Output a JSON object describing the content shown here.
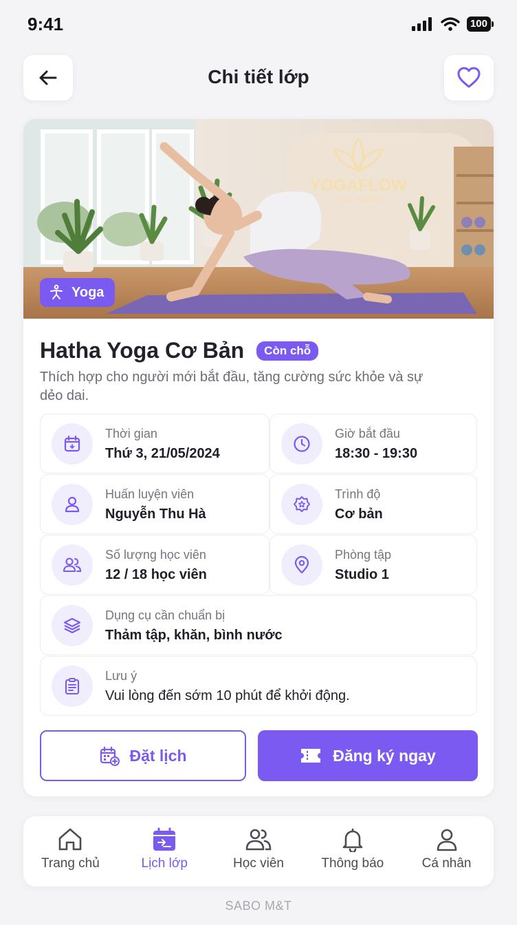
{
  "status_bar": {
    "time": "9:41",
    "battery": "100"
  },
  "header": {
    "title": "Chi tiết lớp"
  },
  "hero": {
    "category": "Yoga",
    "studio_logo": "YOGAFLOW",
    "studio_tagline": "YOGA • PILATES"
  },
  "class": {
    "title": "Hatha Yoga Cơ Bản",
    "availability": "Còn chỗ",
    "description": "Thích hợp cho người mới bắt đầu, tăng cường sức khỏe và sự dẻo dai."
  },
  "details": {
    "date": {
      "label": "Thời gian",
      "value": "Thứ 3, 21/05/2024",
      "icon": "calendar-icon"
    },
    "time": {
      "label": "Giờ bắt đầu",
      "value": "18:30 - 19:30",
      "icon": "clock-icon"
    },
    "trainer": {
      "label": "Huấn luyện viên",
      "value": "Nguyễn Thu Hà",
      "icon": "user-icon"
    },
    "level": {
      "label": "Trình độ",
      "value": "Cơ bản",
      "icon": "badge-star-icon"
    },
    "students": {
      "label": "Số lượng học viên",
      "value": "12 / 18 học viên",
      "icon": "users-icon"
    },
    "room": {
      "label": "Phòng tập",
      "value": "Studio 1",
      "icon": "map-pin-icon"
    },
    "equipment": {
      "label": "Dụng cụ cần chuẩn bị",
      "value": "Thảm tập, khăn, bình nước",
      "icon": "layers-icon"
    },
    "note": {
      "label": "Lưu ý",
      "value": "Vui lòng đến sớm 10 phút để khởi động.",
      "icon": "clipboard-icon"
    }
  },
  "actions": {
    "schedule_label": "Đặt lịch",
    "register_label": "Đăng ký ngay"
  },
  "nav": {
    "items": [
      {
        "label": "Trang chủ",
        "icon": "home-icon"
      },
      {
        "label": "Lịch lớp",
        "icon": "calendar-active-icon"
      },
      {
        "label": "Học viên",
        "icon": "users-icon"
      },
      {
        "label": "Thông báo",
        "icon": "bell-icon"
      },
      {
        "label": "Cá nhân",
        "icon": "user-icon"
      }
    ],
    "active_index": 1
  },
  "footer": {
    "brand": "SABO M&T"
  },
  "colors": {
    "accent": "#7a5af0",
    "accent_light": "#f0edfd",
    "background": "#f4f4f7"
  }
}
